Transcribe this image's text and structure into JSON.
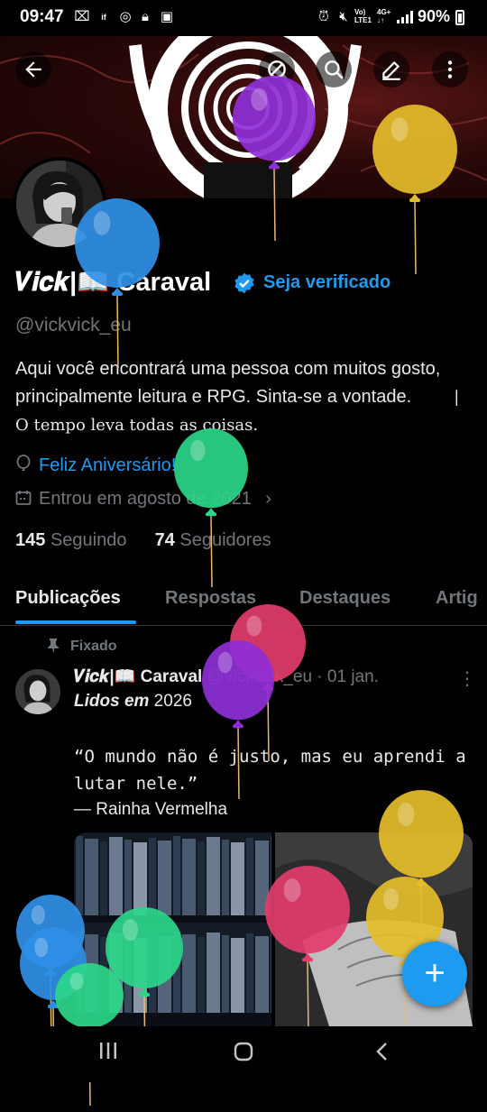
{
  "status_bar": {
    "time": "09:47",
    "battery_pct": "90%",
    "net_top": "Vo)",
    "net_bottom": "LTE1",
    "net2_top": "4G+",
    "net2_bottom": "↓↑"
  },
  "header": {
    "back_icon": "arrow-left-icon",
    "actions": [
      "block-icon",
      "search-icon",
      "edit-icon",
      "more-vertical-icon"
    ]
  },
  "profile": {
    "display_name": "𝑽𝒊𝒄𝒌|📖 Caraval",
    "verify_link": "Seja verificado",
    "handle": "@vickvick_eu",
    "bio_text": "Aqui você encontrará uma pessoa com muitos gosto, principalmente leitura e RPG. Sinta-se a vontade.",
    "bio_quote": "| O tempo leva todas as coisas.",
    "birthday": "Feliz Aniversário!",
    "joined": "Entrou em agosto de 2021",
    "following_count": "145",
    "following_label": "Seguindo",
    "followers_count": "74",
    "followers_label": "Seguidores"
  },
  "tabs": [
    {
      "label": "Publicações",
      "active": true
    },
    {
      "label": "Respostas",
      "active": false
    },
    {
      "label": "Destaques",
      "active": false
    },
    {
      "label": "Artig",
      "active": false
    }
  ],
  "post": {
    "pinned_label": "Fixado",
    "author_name": "𝑽𝒊𝒄𝒌|📖 Caraval",
    "meta": "@vickvick_eu · 01 jan.",
    "line1_bold": "Lidos em",
    "line1_rest": " 2026",
    "quote": "“O mundo não é justo, mas eu aprendi a lutar nele.”",
    "author_line": "— Rainha Vermelha"
  },
  "bottom_nav": {
    "recent_icon": "recent-apps-icon",
    "home_icon": "home-icon",
    "back_icon": "back-icon"
  },
  "colors": {
    "accent": "#1d9bf0",
    "background": "#000000",
    "muted": "#71767b",
    "balloon_purple": "#8e2fd6",
    "balloon_yellow": "#e5bd2a",
    "balloon_blue": "#2f8fe6",
    "balloon_green": "#2bd68a",
    "balloon_pink": "#e23d6b"
  }
}
